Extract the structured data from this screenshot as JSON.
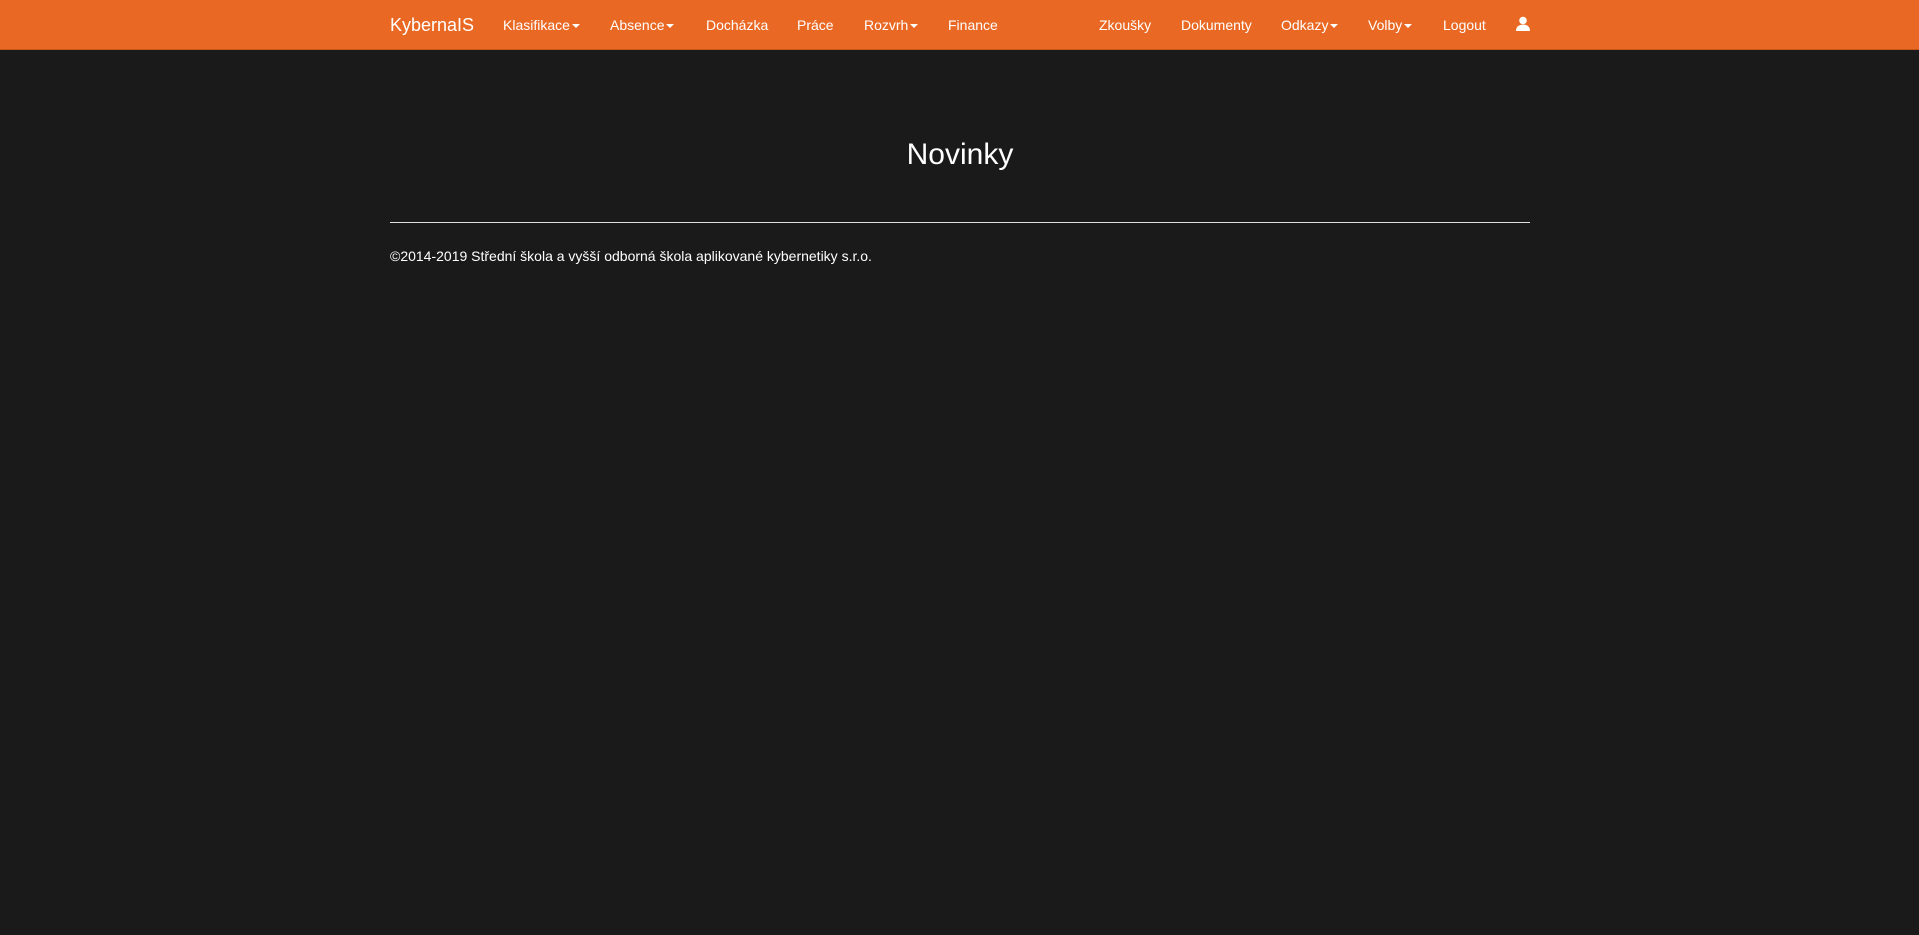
{
  "navbar": {
    "brand": "KybernaIS",
    "left_items": [
      {
        "label": "Klasifikace",
        "dropdown": true
      },
      {
        "label": "Absence",
        "dropdown": true
      },
      {
        "label": "Docházka",
        "dropdown": false
      },
      {
        "label": "Práce",
        "dropdown": false
      },
      {
        "label": "Rozvrh",
        "dropdown": true
      },
      {
        "label": "Finance",
        "dropdown": false
      }
    ],
    "right_items": [
      {
        "label": "Zkoušky",
        "dropdown": false
      },
      {
        "label": "Dokumenty",
        "dropdown": false
      },
      {
        "label": "Odkazy",
        "dropdown": true
      },
      {
        "label": "Volby",
        "dropdown": true
      },
      {
        "label": "Logout",
        "dropdown": false
      }
    ],
    "user_icon": "user-icon",
    "color": "#e96823"
  },
  "main": {
    "title": "Novinky"
  },
  "footer": {
    "copyright": "©2014-2019 Střední škola a vyšší odborná škola aplikované kybernetiky s.r.o."
  },
  "colors": {
    "background": "#1a1a1a",
    "accent": "#e96823",
    "text": "#ffffff"
  }
}
